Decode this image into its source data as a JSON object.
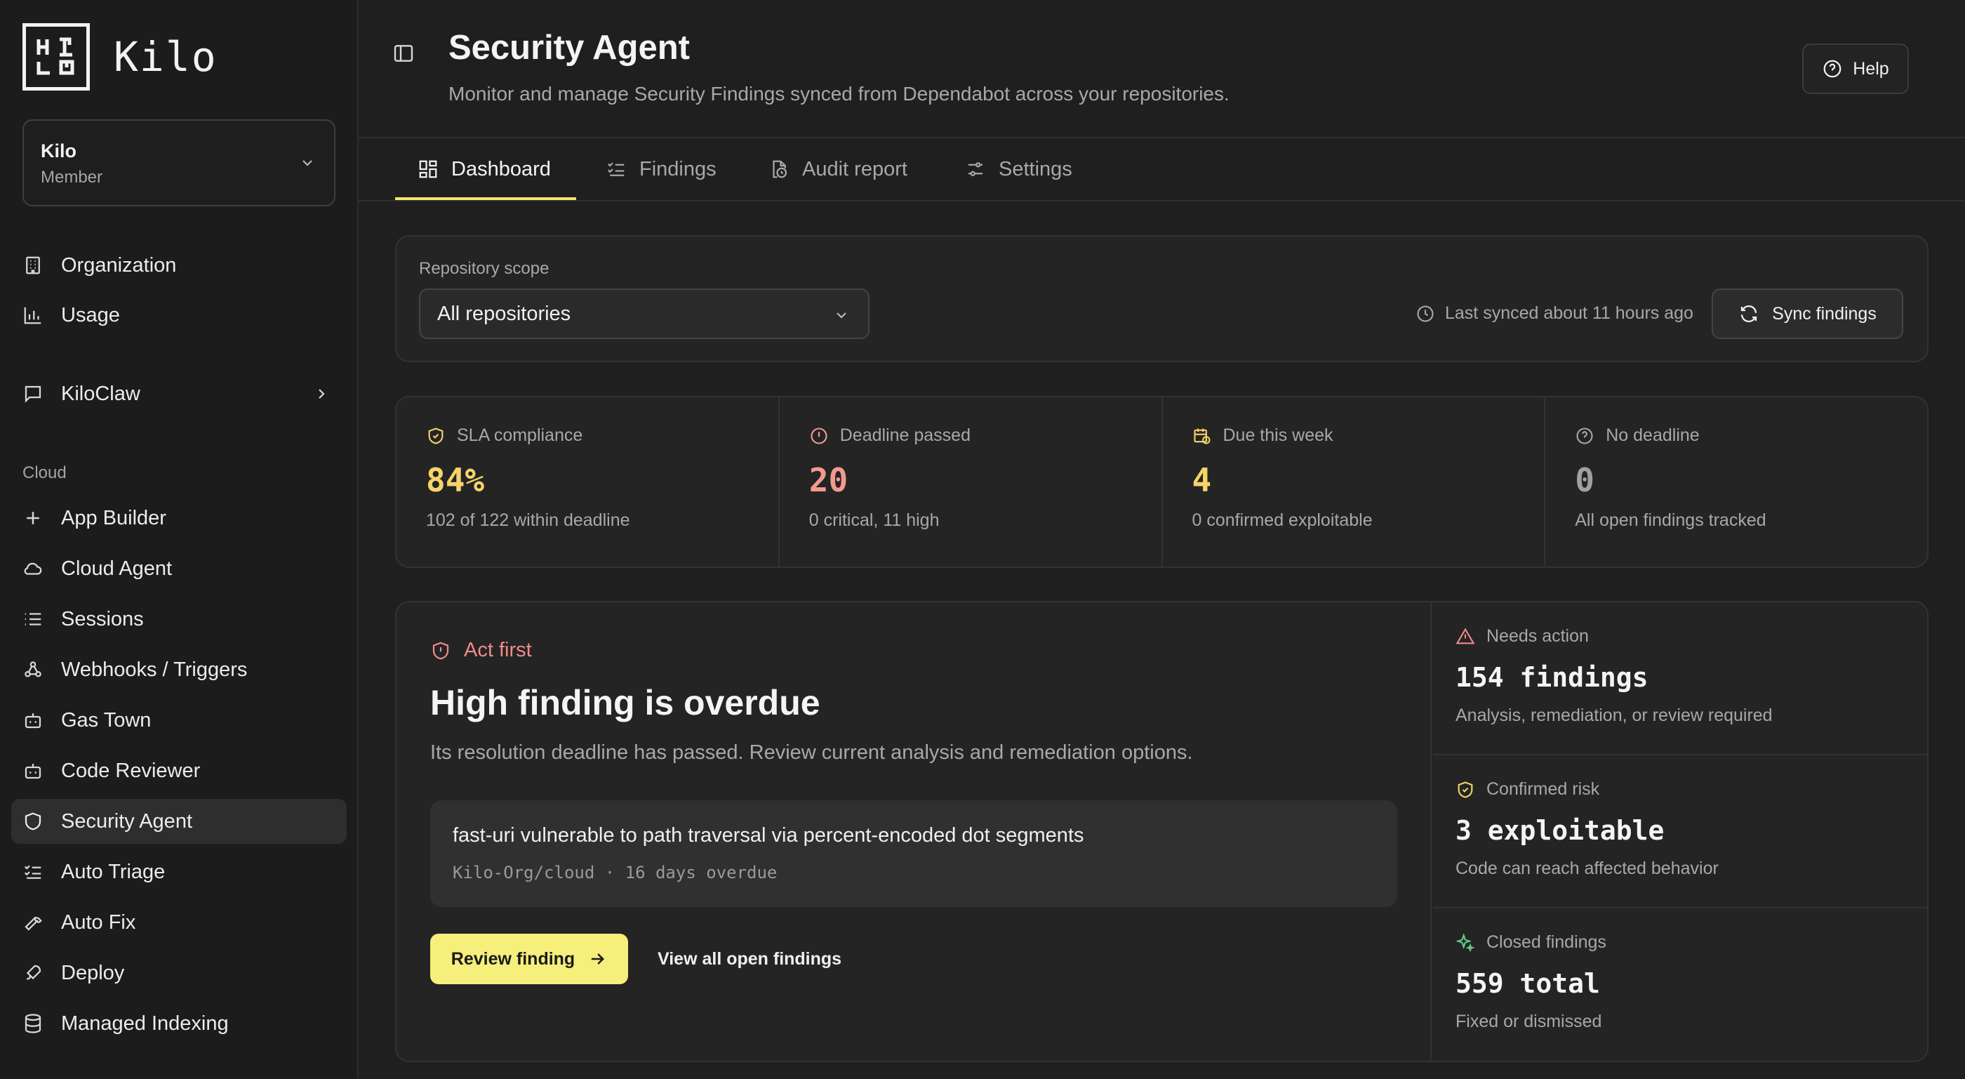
{
  "brand": {
    "name": "Kilo"
  },
  "org": {
    "name": "Kilo",
    "role": "Member"
  },
  "sidebar": {
    "top_items": [
      {
        "label": "Organization"
      },
      {
        "label": "Usage"
      },
      {
        "label": "KiloClaw"
      }
    ],
    "section_label": "Cloud",
    "cloud_items": [
      {
        "label": "App Builder"
      },
      {
        "label": "Cloud Agent"
      },
      {
        "label": "Sessions"
      },
      {
        "label": "Webhooks / Triggers"
      },
      {
        "label": "Gas Town"
      },
      {
        "label": "Code Reviewer"
      },
      {
        "label": "Security Agent"
      },
      {
        "label": "Auto Triage"
      },
      {
        "label": "Auto Fix"
      },
      {
        "label": "Deploy"
      },
      {
        "label": "Managed Indexing"
      }
    ]
  },
  "header": {
    "title": "Security Agent",
    "subtitle": "Monitor and manage Security Findings synced from Dependabot across your repositories.",
    "help_label": "Help"
  },
  "tabs": [
    {
      "label": "Dashboard"
    },
    {
      "label": "Findings"
    },
    {
      "label": "Audit report"
    },
    {
      "label": "Settings"
    }
  ],
  "scope": {
    "label": "Repository scope",
    "selected": "All repositories",
    "sync_status": "Last synced about 11 hours ago",
    "sync_button": "Sync findings"
  },
  "stats": [
    {
      "label": "SLA compliance",
      "value": "84%",
      "sub": "102 of 122 within deadline",
      "color": "#f6d36a"
    },
    {
      "label": "Deadline passed",
      "value": "20",
      "sub": "0 critical, 11 high",
      "color": "#f29a8f"
    },
    {
      "label": "Due this week",
      "value": "4",
      "sub": "0 confirmed exploitable",
      "color": "#f6d36a"
    },
    {
      "label": "No deadline",
      "value": "0",
      "sub": "All open findings tracked",
      "color": "#a0a0a0"
    }
  ],
  "act_first": {
    "label": "Act first",
    "title": "High finding is overdue",
    "description": "Its resolution deadline has passed. Review current analysis and remediation options.",
    "finding_title": "fast-uri vulnerable to path traversal via percent-encoded dot segments",
    "finding_meta": "Kilo-Org/cloud · 16 days overdue",
    "review_button": "Review finding",
    "view_all_link": "View all open findings"
  },
  "summary": [
    {
      "label": "Needs action",
      "value": "154 findings",
      "sub": "Analysis, remediation, or review required"
    },
    {
      "label": "Confirmed risk",
      "value": "3 exploitable",
      "sub": "Code can reach affected behavior"
    },
    {
      "label": "Closed findings",
      "value": "559 total",
      "sub": "Fixed or dismissed"
    }
  ]
}
